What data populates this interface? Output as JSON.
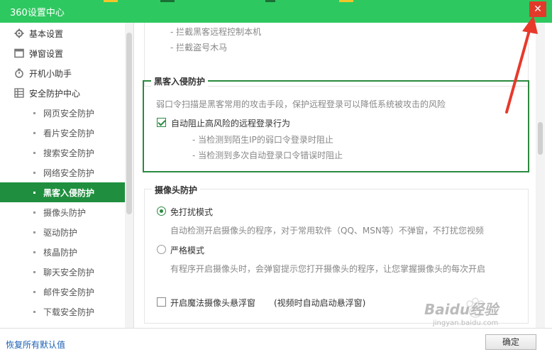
{
  "window": {
    "title": "360设置中心",
    "close_glyph": "✕"
  },
  "sidebar": {
    "groups": [
      {
        "label": "基本设置",
        "icon": "gear-icon"
      },
      {
        "label": "弹窗设置",
        "icon": "window-icon"
      },
      {
        "label": "开机小助手",
        "icon": "stopwatch-icon"
      },
      {
        "label": "安全防护中心",
        "icon": "grid-icon"
      }
    ],
    "items": [
      {
        "label": "网页安全防护"
      },
      {
        "label": "看片安全防护"
      },
      {
        "label": "搜索安全防护"
      },
      {
        "label": "网络安全防护"
      },
      {
        "label": "黑客入侵防护",
        "active": true
      },
      {
        "label": "摄像头防护"
      },
      {
        "label": "驱动防护"
      },
      {
        "label": "核晶防护"
      },
      {
        "label": "聊天安全防护"
      },
      {
        "label": "邮件安全防护"
      },
      {
        "label": "下载安全防护"
      }
    ]
  },
  "main": {
    "top_bullets": [
      "- 拦截黑客远程控制本机",
      "- 拦截盗号木马"
    ],
    "hacker": {
      "title": "黑客入侵防护",
      "description": "弱口令扫描是黑客常用的攻击手段，保护远程登录可以降低系统被攻击的风险",
      "checkbox_label": "自动阻止高风险的远程登录行为",
      "checkbox_checked": true,
      "sub_items": [
        "- 当检测到陌生IP的弱口令登录时阻止",
        "- 当检测到多次自动登录口令错误时阻止"
      ]
    },
    "camera": {
      "title": "摄像头防护",
      "mode_free_label": "免打扰模式",
      "mode_free_desc": "自动检测开启摄像头的程序，对于常用软件（QQ、MSN等）不弹窗，不打扰您视频",
      "mode_strict_label": "严格模式",
      "mode_strict_desc": "有程序开启摄像头时，会弹窗提示您打开摄像头的程序，让您掌握摄像头的每次开启",
      "selected": "free",
      "float_label": "开启魔法摄像头悬浮窗",
      "float_note": "(视频时自动启动悬浮窗)",
      "float_checked": false
    }
  },
  "footer": {
    "restore_label": "恢复所有默认值",
    "ok_label": "确定"
  },
  "watermark": {
    "brand": "Baidu经验",
    "url": "jingyan.baidu.com"
  },
  "colors": {
    "titlebar": "#2ec860",
    "active_nav": "#1f8f3f",
    "box_border": "#2a8a3f",
    "close": "#e23a2a",
    "annotation_arrow": "#e8392b"
  }
}
